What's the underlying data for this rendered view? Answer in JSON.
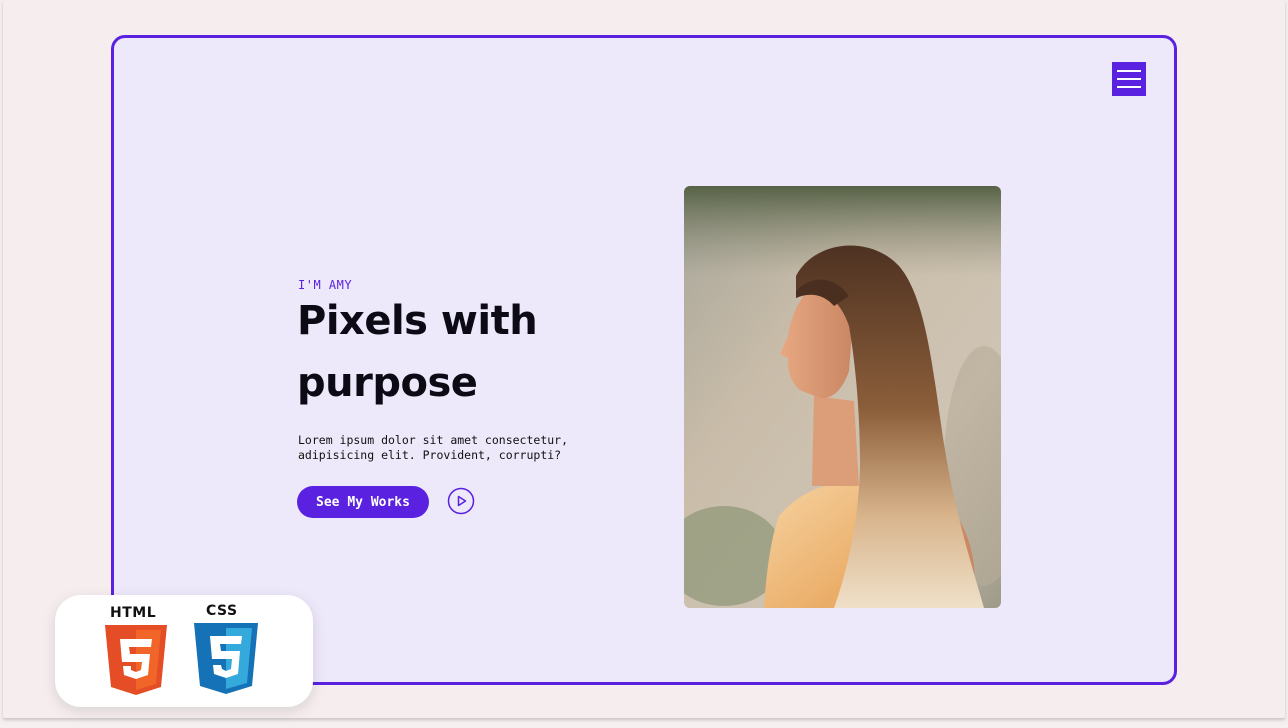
{
  "hero": {
    "intro": "I'M AMY",
    "headline_line1": "Pixels with",
    "headline_line2": "purpose",
    "description_line1": "Lorem ipsum dolor sit amet consectetur,",
    "description_line2": "adipisicing elit. Provident, corrupti?",
    "cta_label": "See My Works"
  },
  "badges": {
    "html_label": "HTML",
    "html_number": "5",
    "css_label": "CSS",
    "css_number": "3"
  },
  "icons": {
    "menu": "hamburger-menu-icon",
    "play": "play-circle-icon"
  },
  "colors": {
    "accent": "#5a22e0",
    "frame_bg": "#ede8fa",
    "page_bg": "#f5efef",
    "html_orange": "#e44d26",
    "css_blue": "#1572b6"
  }
}
